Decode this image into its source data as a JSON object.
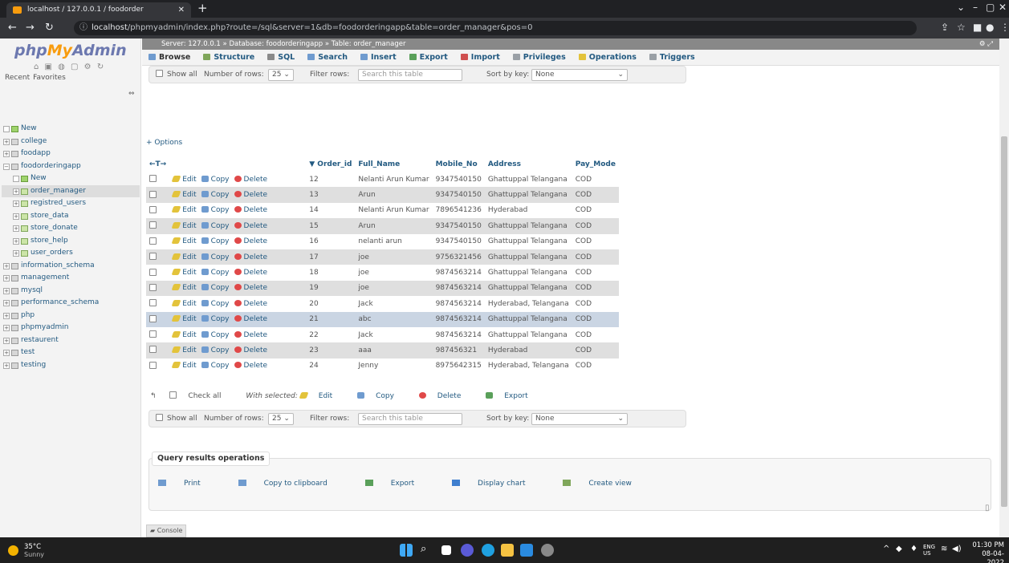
{
  "browser": {
    "tab_title": "localhost / 127.0.0.1 / foodorder",
    "url_host": "localhost",
    "url_path": "/phpmyadmin/index.php?route=/sql&server=1&db=foodorderingapp&table=order_manager&pos=0"
  },
  "nav": {
    "logo_php": "php",
    "logo_my": "My",
    "logo_admin": "Admin",
    "recent": "Recent",
    "favorites": "Favorites",
    "tree": [
      {
        "label": "New",
        "level": 0,
        "type": "new"
      },
      {
        "label": "college",
        "level": 0
      },
      {
        "label": "foodapp",
        "level": 0
      },
      {
        "label": "foodorderingapp",
        "level": 0,
        "open": true
      },
      {
        "label": "New",
        "level": 1,
        "type": "new"
      },
      {
        "label": "order_manager",
        "level": 1,
        "active": true
      },
      {
        "label": "registred_users",
        "level": 1
      },
      {
        "label": "store_data",
        "level": 1
      },
      {
        "label": "store_donate",
        "level": 1
      },
      {
        "label": "store_help",
        "level": 1
      },
      {
        "label": "user_orders",
        "level": 1
      },
      {
        "label": "information_schema",
        "level": 0
      },
      {
        "label": "management",
        "level": 0
      },
      {
        "label": "mysql",
        "level": 0
      },
      {
        "label": "performance_schema",
        "level": 0
      },
      {
        "label": "php",
        "level": 0
      },
      {
        "label": "phpmyadmin",
        "level": 0
      },
      {
        "label": "restaurent",
        "level": 0
      },
      {
        "label": "test",
        "level": 0
      },
      {
        "label": "testing",
        "level": 0
      }
    ]
  },
  "breadcrumb": {
    "server": "Server: 127.0.0.1",
    "database": "Database: foodorderingapp",
    "table": "Table: order_manager"
  },
  "menu": {
    "tabs": [
      {
        "label": "Browse",
        "color": "#6f9bcf"
      },
      {
        "label": "Structure",
        "color": "#7fa65a"
      },
      {
        "label": "SQL",
        "color": "#8a8a8a"
      },
      {
        "label": "Search",
        "color": "#6f9bcf"
      },
      {
        "label": "Insert",
        "color": "#6f9bcf"
      },
      {
        "label": "Export",
        "color": "#5aa05a"
      },
      {
        "label": "Import",
        "color": "#d05050"
      },
      {
        "label": "Privileges",
        "color": "#9aa0a6"
      },
      {
        "label": "Operations",
        "color": "#e3c33b"
      },
      {
        "label": "Triggers",
        "color": "#9aa0a6"
      }
    ]
  },
  "controls": {
    "show_all": "Show all",
    "number_of_rows": "Number of rows:",
    "rows_value": "25",
    "filter_rows": "Filter rows:",
    "filter_placeholder": "Search this table",
    "sort_by_key": "Sort by key:",
    "sort_value": "None"
  },
  "options_link": "+ Options",
  "nav_arrows": "←T→",
  "table": {
    "columns": [
      "Order_id",
      "Full_Name",
      "Mobile_No",
      "Address",
      "Pay_Mode"
    ],
    "sort_icon": "▼",
    "actions": {
      "edit": "Edit",
      "copy": "Copy",
      "delete": "Delete"
    },
    "rows": [
      {
        "Order_id": "12",
        "Full_Name": "Nelanti Arun Kumar",
        "Mobile_No": "9347540150",
        "Address": "Ghattuppal Telangana",
        "Pay_Mode": "COD"
      },
      {
        "Order_id": "13",
        "Full_Name": "Arun",
        "Mobile_No": "9347540150",
        "Address": "Ghattuppal Telangana",
        "Pay_Mode": "COD"
      },
      {
        "Order_id": "14",
        "Full_Name": "Nelanti Arun Kumar",
        "Mobile_No": "7896541236",
        "Address": "Hyderabad",
        "Pay_Mode": "COD"
      },
      {
        "Order_id": "15",
        "Full_Name": "Arun",
        "Mobile_No": "9347540150",
        "Address": "Ghattuppal Telangana",
        "Pay_Mode": "COD"
      },
      {
        "Order_id": "16",
        "Full_Name": "nelanti arun",
        "Mobile_No": "9347540150",
        "Address": "Ghattuppal Telangana",
        "Pay_Mode": "COD"
      },
      {
        "Order_id": "17",
        "Full_Name": "joe",
        "Mobile_No": "9756321456",
        "Address": "Ghattuppal Telangana",
        "Pay_Mode": "COD"
      },
      {
        "Order_id": "18",
        "Full_Name": "joe",
        "Mobile_No": "9874563214",
        "Address": "Ghattuppal Telangana",
        "Pay_Mode": "COD"
      },
      {
        "Order_id": "19",
        "Full_Name": "joe",
        "Mobile_No": "9874563214",
        "Address": "Ghattuppal Telangana",
        "Pay_Mode": "COD"
      },
      {
        "Order_id": "20",
        "Full_Name": "Jack",
        "Mobile_No": "9874563214",
        "Address": "Hyderabad, Telangana",
        "Pay_Mode": "COD"
      },
      {
        "Order_id": "21",
        "Full_Name": "abc",
        "Mobile_No": "9874563214",
        "Address": "Ghattuppal Telangana",
        "Pay_Mode": "COD"
      },
      {
        "Order_id": "22",
        "Full_Name": "Jack",
        "Mobile_No": "9874563214",
        "Address": "Ghattuppal Telangana",
        "Pay_Mode": "COD"
      },
      {
        "Order_id": "23",
        "Full_Name": "aaa",
        "Mobile_No": "987456321",
        "Address": "Hyderabad",
        "Pay_Mode": "COD"
      },
      {
        "Order_id": "24",
        "Full_Name": "Jenny",
        "Mobile_No": "8975642315",
        "Address": "Hyderabad, Telangana",
        "Pay_Mode": "COD"
      }
    ]
  },
  "bulk": {
    "check_all": "Check all",
    "with_selected": "With selected:",
    "edit": "Edit",
    "copy": "Copy",
    "delete": "Delete",
    "export": "Export"
  },
  "query_results": {
    "legend": "Query results operations",
    "print": "Print",
    "copy_clipboard": "Copy to clipboard",
    "export": "Export",
    "display_chart": "Display chart",
    "create_view": "Create view"
  },
  "console": "Console",
  "taskbar": {
    "temp": "35°C",
    "condition": "Sunny",
    "lang_top": "ENG",
    "lang_bottom": "US",
    "time": "01:30 PM",
    "date": "08-04-2022"
  }
}
